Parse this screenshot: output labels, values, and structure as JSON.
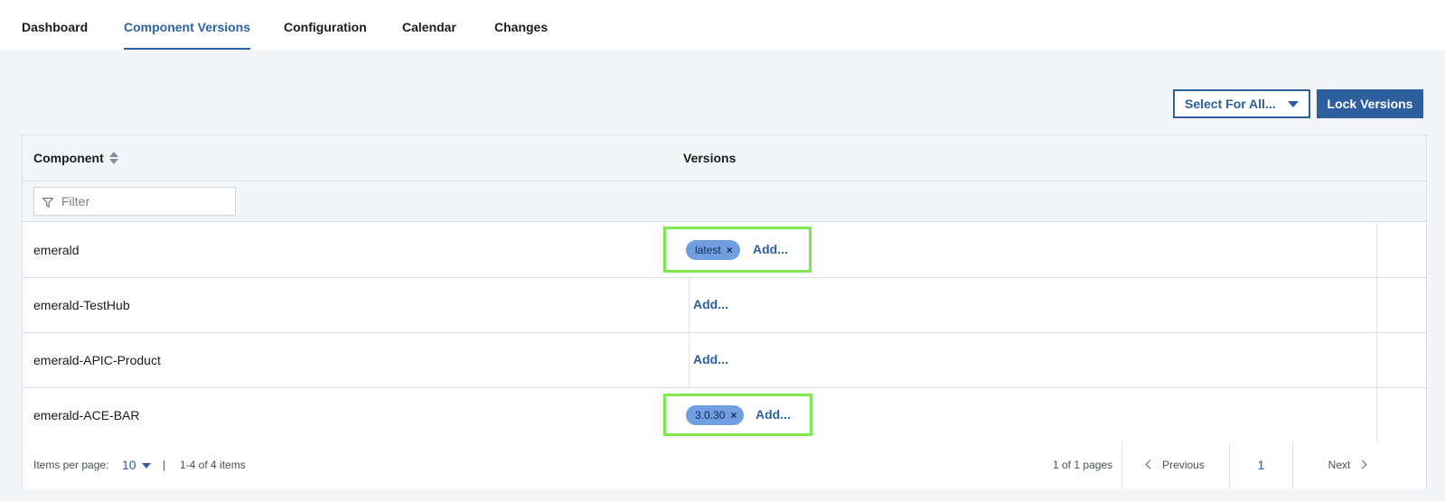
{
  "nav": {
    "tabs": [
      {
        "label": "Dashboard",
        "active": false
      },
      {
        "label": "Component Versions",
        "active": true
      },
      {
        "label": "Configuration",
        "active": false
      },
      {
        "label": "Calendar",
        "active": false
      },
      {
        "label": "Changes",
        "active": false
      }
    ]
  },
  "toolbar": {
    "select_for_all_label": "Select For All...",
    "lock_versions_label": "Lock Versions"
  },
  "table": {
    "columns": {
      "component": "Component",
      "versions": "Versions"
    },
    "filter": {
      "placeholder": "Filter",
      "value": ""
    },
    "rows": [
      {
        "component": "emerald",
        "versions": [
          "latest"
        ],
        "add_label": "Add...",
        "highlighted": true
      },
      {
        "component": "emerald-TestHub",
        "versions": [],
        "add_label": "Add...",
        "highlighted": false
      },
      {
        "component": "emerald-APIC-Product",
        "versions": [],
        "add_label": "Add...",
        "highlighted": false
      },
      {
        "component": "emerald-ACE-BAR",
        "versions": [
          "3.0.30"
        ],
        "add_label": "Add...",
        "highlighted": true
      }
    ],
    "chip_remove_glyph": "×"
  },
  "pagination": {
    "items_per_page_label": "Items per page:",
    "items_per_page_value": "10",
    "separator": "|",
    "range_text": "1-4 of 4 items",
    "pages_text": "1 of 1 pages",
    "previous_label": "Previous",
    "current_page": "1",
    "next_label": "Next"
  },
  "colors": {
    "accent": "#2d5f9e",
    "chip": "#6f9fe0",
    "highlight": "#7ee84f"
  }
}
